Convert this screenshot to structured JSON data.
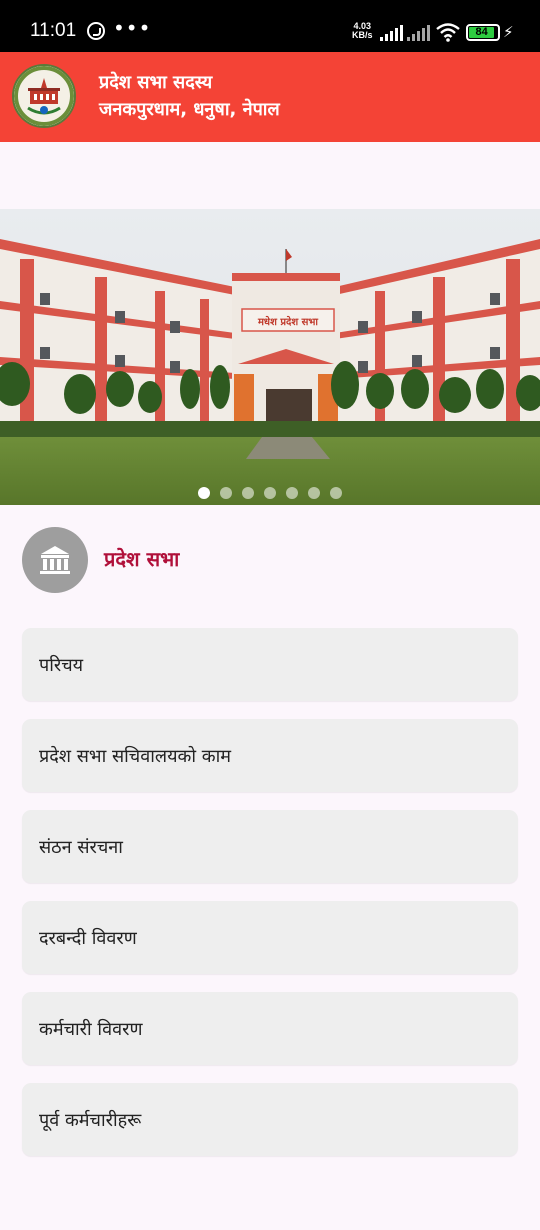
{
  "status_bar": {
    "time": "11:01",
    "net_speed_value": "4.03",
    "net_speed_unit": "KB/s",
    "battery": "84",
    "icons": [
      "whatsapp-icon",
      "more-dots-icon",
      "signal-icon",
      "signal-no-data-icon",
      "wifi-icon",
      "battery-icon",
      "charging-icon"
    ]
  },
  "app_bar": {
    "title": "प्रदेश सभा सदस्य",
    "subtitle": "जनकपुरधाम, धनुषा, नेपाल",
    "accent_color": "#f44336"
  },
  "carousel": {
    "building_sign": "मधेश प्रदेश सभा",
    "slide_count": 7,
    "active_index": 0
  },
  "section": {
    "title": "प्रदेश सभा",
    "icon": "institution-icon",
    "title_color": "#b0103a"
  },
  "menu": [
    {
      "label": "परिचय"
    },
    {
      "label": "प्रदेश सभा सचिवालयको काम"
    },
    {
      "label": "संठन संरचना"
    },
    {
      "label": "दरबन्दी विवरण"
    },
    {
      "label": "कर्मचारी विवरण"
    },
    {
      "label": "पूर्व कर्मचारीहरू"
    }
  ]
}
